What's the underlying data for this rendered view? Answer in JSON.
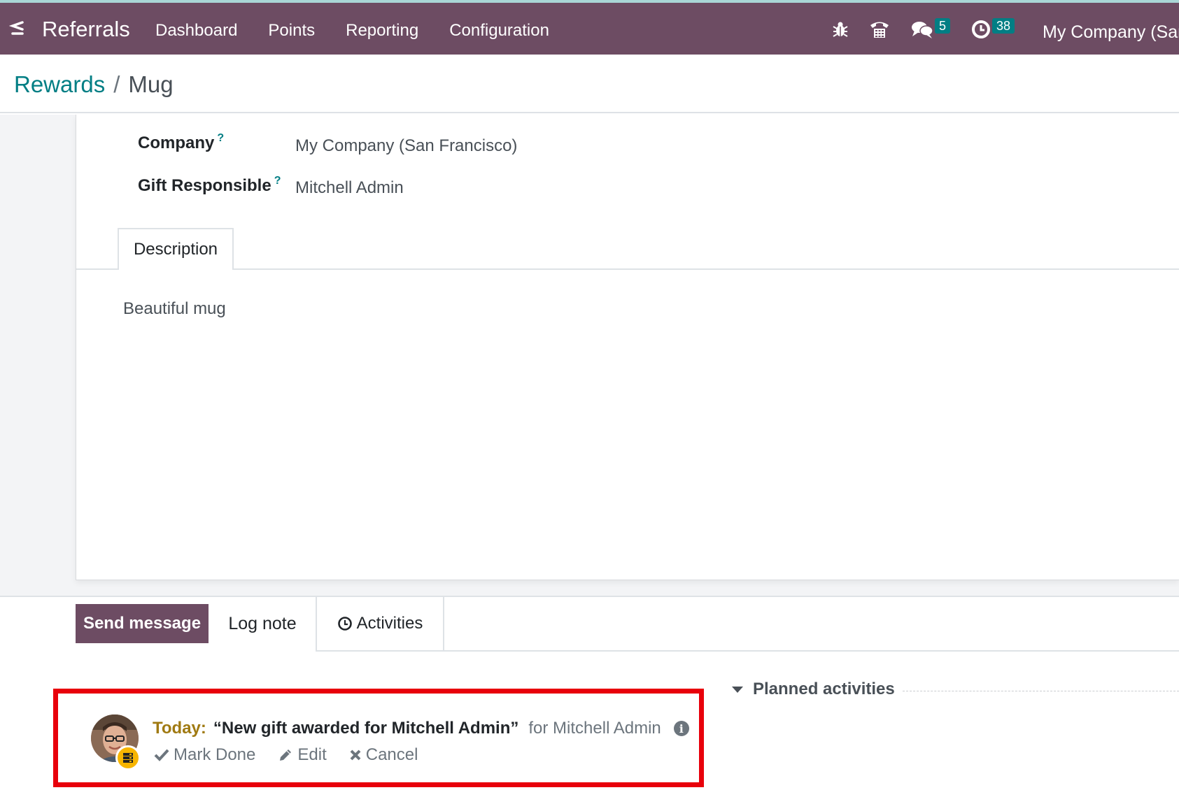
{
  "navbar": {
    "app_name": "Referrals",
    "menu": [
      "Dashboard",
      "Points",
      "Reporting",
      "Configuration"
    ],
    "messages_count": "5",
    "activities_count": "38",
    "company": "My Company (San"
  },
  "breadcrumb": {
    "parent": "Rewards",
    "separator": "/",
    "current": "Mug"
  },
  "form": {
    "company_label": "Company",
    "company_value": "My Company (San Francisco)",
    "gift_responsible_label": "Gift Responsible",
    "gift_responsible_value": "Mitchell Admin",
    "help_mark": "?",
    "tab_description": "Description",
    "description_text": "Beautiful mug"
  },
  "chatter": {
    "send_message": "Send message",
    "log_note": "Log note",
    "activities": "Activities",
    "planned_activities": "Planned activities"
  },
  "activity": {
    "due": "Today:",
    "summary": "“New gift awarded for Mitchell Admin”",
    "assignee": "for Mitchell Admin",
    "mark_done": "Mark Done",
    "edit": "Edit",
    "cancel": "Cancel"
  },
  "colors": {
    "navbar": "#6d4c63",
    "accent": "#017e84",
    "highlight": "#e8000b",
    "today": "#a07a12"
  },
  "icons": [
    "apps-icon",
    "bug-icon",
    "phone-icon",
    "chat-icon",
    "clock-icon",
    "info-icon",
    "check-icon",
    "pencil-icon",
    "times-icon",
    "caret-down-icon"
  ]
}
